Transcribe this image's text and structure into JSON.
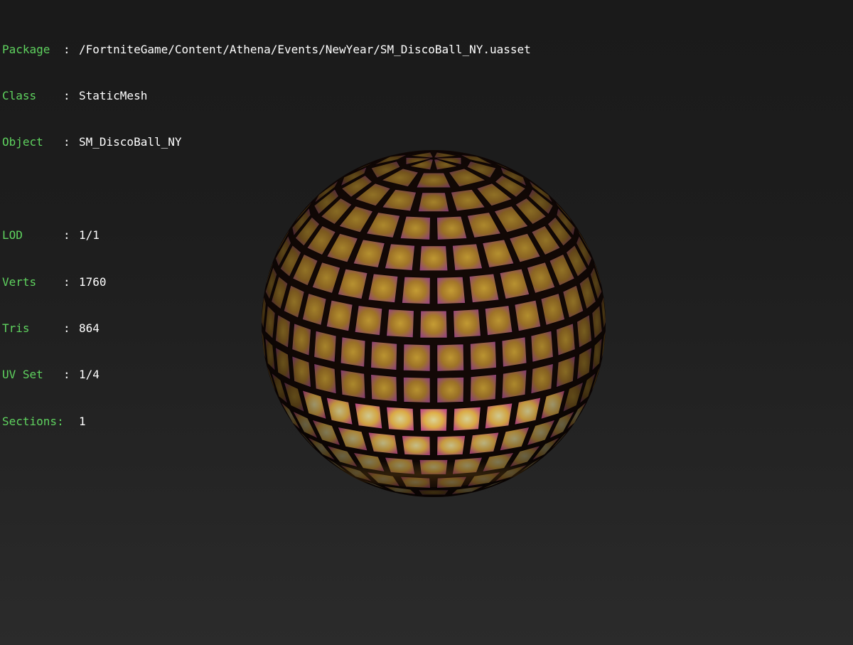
{
  "info": {
    "package": {
      "label": "Package",
      "separator": ":",
      "value": "/FortniteGame/Content/Athena/Events/NewYear/SM_DiscoBall_NY.uasset"
    },
    "class": {
      "label": "Class",
      "separator": ":",
      "value": "StaticMesh"
    },
    "object": {
      "label": "Object",
      "separator": ":",
      "value": "SM_DiscoBall_NY"
    },
    "lod": {
      "label": "LOD",
      "separator": ":",
      "value": "1/1"
    },
    "verts": {
      "label": "Verts",
      "separator": ":",
      "value": "1760"
    },
    "tris": {
      "label": "Tris",
      "separator": ":",
      "value": "864"
    },
    "uvset": {
      "label": "UV Set",
      "separator": ":",
      "value": "1/4"
    },
    "sections": {
      "label": "Sections",
      "separator": ":",
      "value": "1"
    }
  },
  "colors": {
    "label_green": "#5fd35f",
    "value_white": "#ffffff",
    "background_top": "#1a1a1a",
    "background_bottom": "#2b2b2b",
    "tile_gold": "#c9a03a",
    "tile_pink": "#d85a8a",
    "tile_glow": "#fff2a0",
    "grout": "#120806"
  },
  "mesh": {
    "name": "disco-ball",
    "icon": "disco-ball-mesh"
  }
}
